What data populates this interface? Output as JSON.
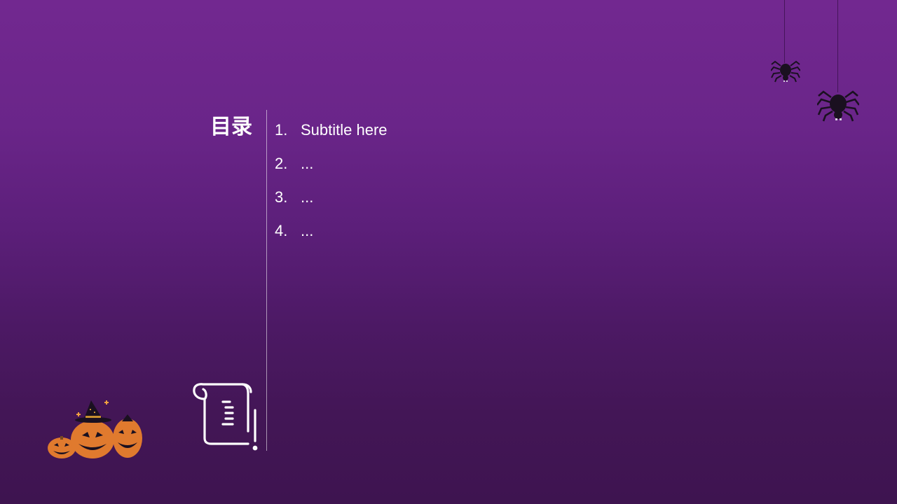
{
  "slide": {
    "title": "目录",
    "items": [
      {
        "number": "1.",
        "label": "Subtitle here"
      },
      {
        "number": "2.",
        "label": "..."
      },
      {
        "number": "3.",
        "label": "..."
      },
      {
        "number": "4.",
        "label": "..."
      }
    ]
  },
  "icons": {
    "scroll": "scroll-icon",
    "spider": "spider-icon",
    "pumpkins": "jack-o-lantern-icon",
    "witch_hat": "witch-hat-icon"
  },
  "colors": {
    "background_top": "#722890",
    "background_bottom": "#3e1450",
    "text": "#ffffff",
    "pumpkin": "#e07a2e",
    "spider": "#1a1020"
  }
}
